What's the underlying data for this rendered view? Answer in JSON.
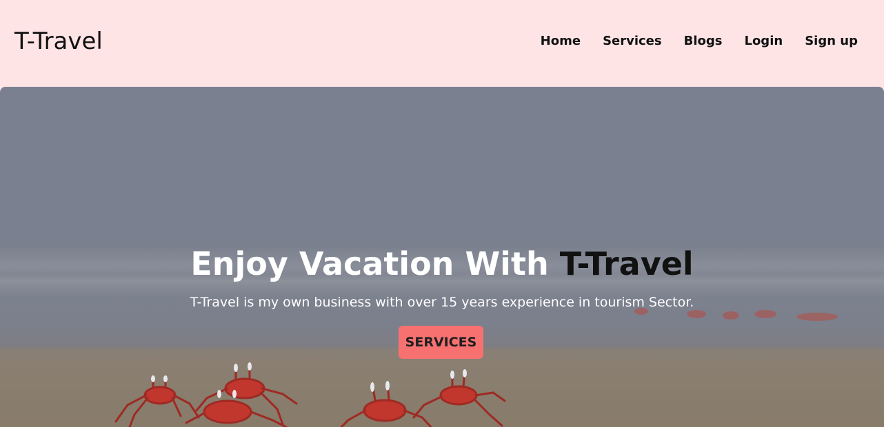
{
  "brand": {
    "name": "T-Travel"
  },
  "nav": {
    "items": [
      {
        "label": "Home"
      },
      {
        "label": "Services"
      },
      {
        "label": "Blogs"
      },
      {
        "label": "Login"
      },
      {
        "label": "Sign up"
      }
    ]
  },
  "hero": {
    "title_prefix": "Enjoy Vacation With ",
    "title_accent": "T-Travel",
    "subtitle": "T-Travel is my own business with over 15 years experience in tourism Sector.",
    "cta_label": "SERVICES"
  },
  "colors": {
    "header_bg": "#ffe4e6",
    "cta_bg": "#f87171",
    "accent_text": "#111111"
  }
}
